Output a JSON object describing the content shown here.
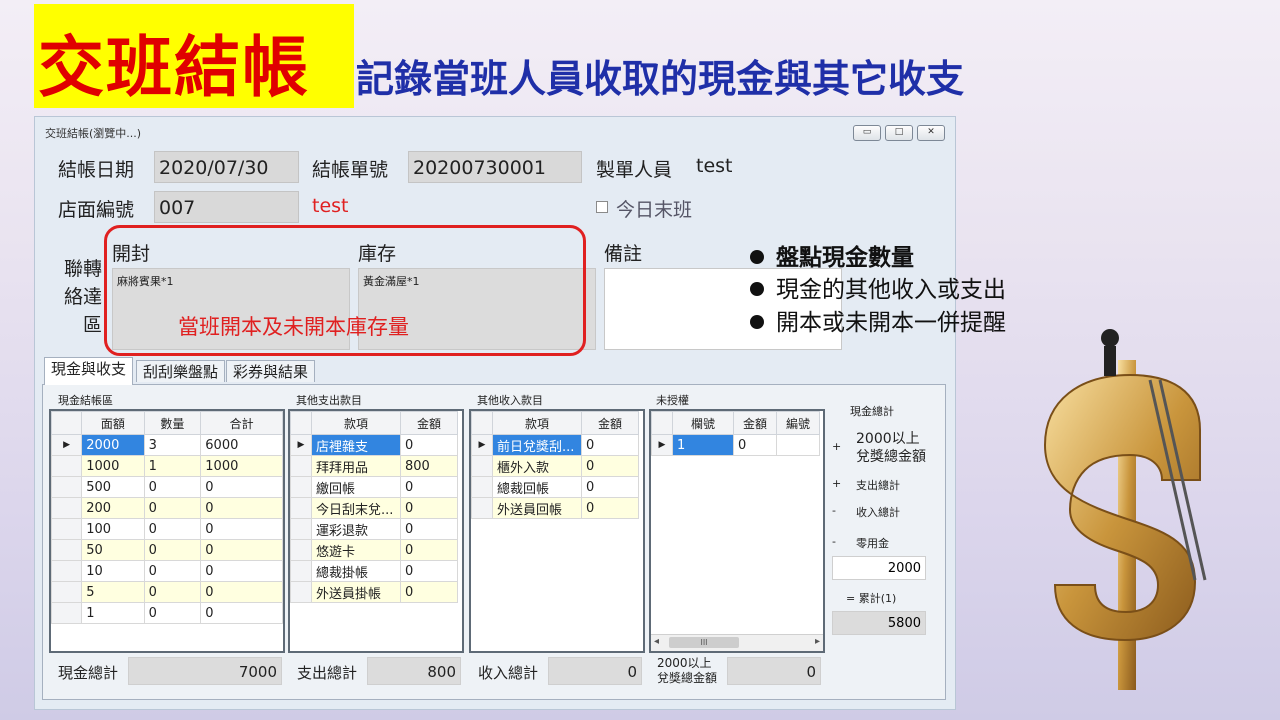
{
  "slide": {
    "title": "交班結帳",
    "subtitle": "記錄當班人員收取的現金與其它收支",
    "bullets": [
      "盤點現金數量",
      "現金的其他收入或支出",
      "開本或未開本一併提醒"
    ],
    "callout": "當班開本及未開本庫存量"
  },
  "window": {
    "title": "交班結帳(瀏覽中...)",
    "controls": {
      "minimize": "▭",
      "maximize": "□",
      "close": "✕"
    }
  },
  "form": {
    "date_label": "結帳日期",
    "date_value": "2020/07/30",
    "doc_label": "結帳單號",
    "doc_value": "20200730001",
    "maker_label": "製單人員",
    "maker_value": "test",
    "store_label": "店面編號",
    "store_value": "007",
    "store_name": "test",
    "last_shift_label": "今日末班",
    "contact_label": "聯轉\n絡達\n區",
    "open_label": "開封",
    "open_value": "麻將賓果*1",
    "stock_label": "庫存",
    "stock_value": "黃金滿屋*1",
    "memo_label": "備註",
    "memo_value": ""
  },
  "tabs": [
    "現金與收支",
    "刮刮樂盤點",
    "彩券與結果"
  ],
  "cash": {
    "title": "現金結帳區",
    "columns": [
      "面額",
      "數量",
      "合計"
    ],
    "rows": [
      [
        "2000",
        "3",
        "6000"
      ],
      [
        "1000",
        "1",
        "1000"
      ],
      [
        "500",
        "0",
        "0"
      ],
      [
        "200",
        "0",
        "0"
      ],
      [
        "100",
        "0",
        "0"
      ],
      [
        "50",
        "0",
        "0"
      ],
      [
        "10",
        "0",
        "0"
      ],
      [
        "5",
        "0",
        "0"
      ],
      [
        "1",
        "0",
        "0"
      ]
    ],
    "total_label": "現金總計",
    "total_value": "7000"
  },
  "expense": {
    "title": "其他支出款目",
    "columns": [
      "款項",
      "金額"
    ],
    "rows": [
      [
        "店裡雜支",
        "0"
      ],
      [
        "拜拜用品",
        "800"
      ],
      [
        "繳回帳",
        "0"
      ],
      [
        "今日刮末兌...",
        "0"
      ],
      [
        "運彩退款",
        "0"
      ],
      [
        "悠遊卡",
        "0"
      ],
      [
        "總裁掛帳",
        "0"
      ],
      [
        "外送員掛帳",
        "0"
      ]
    ],
    "total_label": "支出總計",
    "total_value": "800"
  },
  "income": {
    "title": "其他收入款目",
    "columns": [
      "款項",
      "金額"
    ],
    "rows": [
      [
        "前日兌獎刮...",
        "0"
      ],
      [
        "櫃外入款",
        "0"
      ],
      [
        "總裁回帳",
        "0"
      ],
      [
        "外送員回帳",
        "0"
      ]
    ],
    "total_label": "收入總計",
    "total_value": "0"
  },
  "unauth": {
    "title": "未授權",
    "columns": [
      "欄號",
      "金額",
      "編號"
    ],
    "rows": [
      [
        "1",
        "0",
        ""
      ]
    ],
    "scroll_thumb": "III",
    "total_label": "2000以上\n兌獎總金額",
    "total_value": "0"
  },
  "summary": {
    "cash_total_label": "現金總計",
    "plus1": "+",
    "prize_label": "2000以上\n兌獎總金額",
    "plus2": "+",
    "expense_label": "支出總計",
    "minus1": "-",
    "income_label": "收入總計",
    "minus2": "-",
    "petty_label": "零用金",
    "petty_value": "2000",
    "cumulative_label": "= 累計(1)",
    "cumulative_value": "5800"
  }
}
